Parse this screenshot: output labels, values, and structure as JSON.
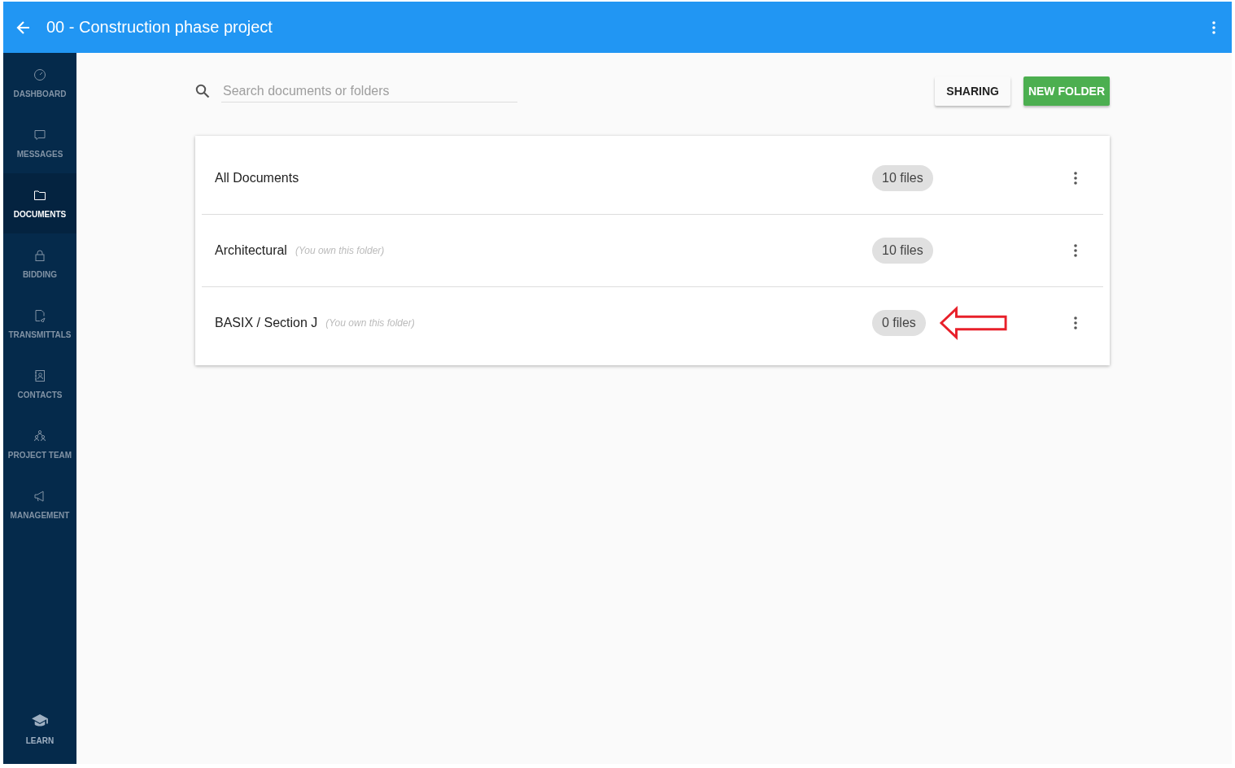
{
  "header": {
    "title": "00 - Construction phase project"
  },
  "sidebar": {
    "items": [
      {
        "label": "DASHBOARD",
        "selected": false
      },
      {
        "label": "MESSAGES",
        "selected": false
      },
      {
        "label": "DOCUMENTS",
        "selected": true
      },
      {
        "label": "BIDDING",
        "selected": false
      },
      {
        "label": "TRANSMITTALS",
        "selected": false
      },
      {
        "label": "CONTACTS",
        "selected": false
      },
      {
        "label": "PROJECT TEAM",
        "selected": false
      },
      {
        "label": "MANAGEMENT",
        "selected": false
      }
    ],
    "bottom": {
      "label": "LEARN"
    }
  },
  "search": {
    "placeholder": "Search documents or folders"
  },
  "buttons": {
    "sharing": "SHARING",
    "new_folder": "NEW FOLDER"
  },
  "folders": [
    {
      "name": "All Documents",
      "count": "10 files",
      "highlighted": false
    },
    {
      "name": "Architectural",
      "note": "(You own this folder)",
      "count": "10 files",
      "highlighted": false
    },
    {
      "name": "BASIX / Section J",
      "note": "(You own this folder)",
      "count": "0 files",
      "highlighted": true
    }
  ]
}
